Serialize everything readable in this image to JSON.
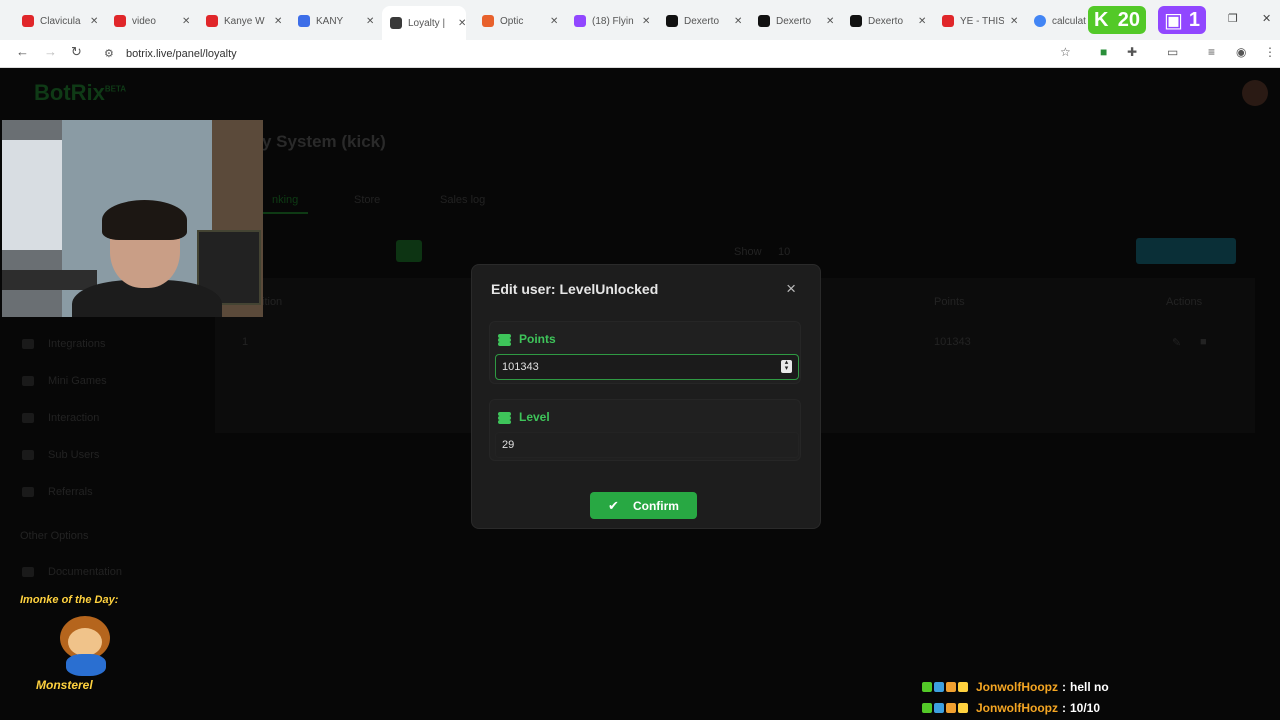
{
  "browser": {
    "tabs": [
      {
        "label": "Clavicula",
        "color": "#e0262a"
      },
      {
        "label": "video",
        "color": "#e0262a"
      },
      {
        "label": "Kanye W",
        "color": "#e0262a"
      },
      {
        "label": "KANY",
        "color": "#3d6ee8"
      },
      {
        "label": "Loyalty |",
        "color": "#3a3a3a",
        "active": true
      },
      {
        "label": "Optic",
        "color": "#e8612c"
      },
      {
        "label": "(18) Flyin",
        "color": "#9147ff"
      },
      {
        "label": "Dexerto",
        "color": "#111111"
      },
      {
        "label": "Dexerto",
        "color": "#111111"
      },
      {
        "label": "Dexerto",
        "color": "#111111"
      },
      {
        "label": "YE - THIS",
        "color": "#e0262a"
      },
      {
        "label": "calculat",
        "color": "#4285f4"
      }
    ],
    "url": "botrix.live/panel/loyalty",
    "overlay_counts": {
      "kick": "20",
      "twitch": "1"
    }
  },
  "app": {
    "logo": "BotRix",
    "logo_tag": "BETA",
    "page_title": "y System (kick)",
    "tabs": [
      "nking",
      "Store",
      "Sales log"
    ],
    "show_label": "Show",
    "show_value": "10",
    "col_position": "ition",
    "col_points": "Points",
    "col_actions": "Actions",
    "row_rank": "1",
    "row_points": "101343",
    "sidebar": [
      "Integrations",
      "Mini Games",
      "Interaction",
      "Sub Users",
      "Referrals"
    ],
    "other_options": "Other Options",
    "documentation": "Documentation"
  },
  "modal": {
    "title": "Edit user: LevelUnlocked",
    "close": "×",
    "points_label": "Points",
    "points_value": "101343",
    "level_label": "Level",
    "level_value": "29",
    "confirm_label": "Confirm"
  },
  "overlay": {
    "motd_title": "Imonke of the Day:",
    "motd_name": "Monsterel",
    "chat": [
      {
        "user": "JonwolfHoopz",
        "sep": ":",
        "message": "hell no"
      },
      {
        "user": "JonwolfHoopz",
        "sep": ":",
        "message": "10/10"
      }
    ]
  },
  "colors": {
    "accent_green": "#28a843",
    "label_green": "#3ec45a",
    "chat_user": "#f5a623"
  }
}
